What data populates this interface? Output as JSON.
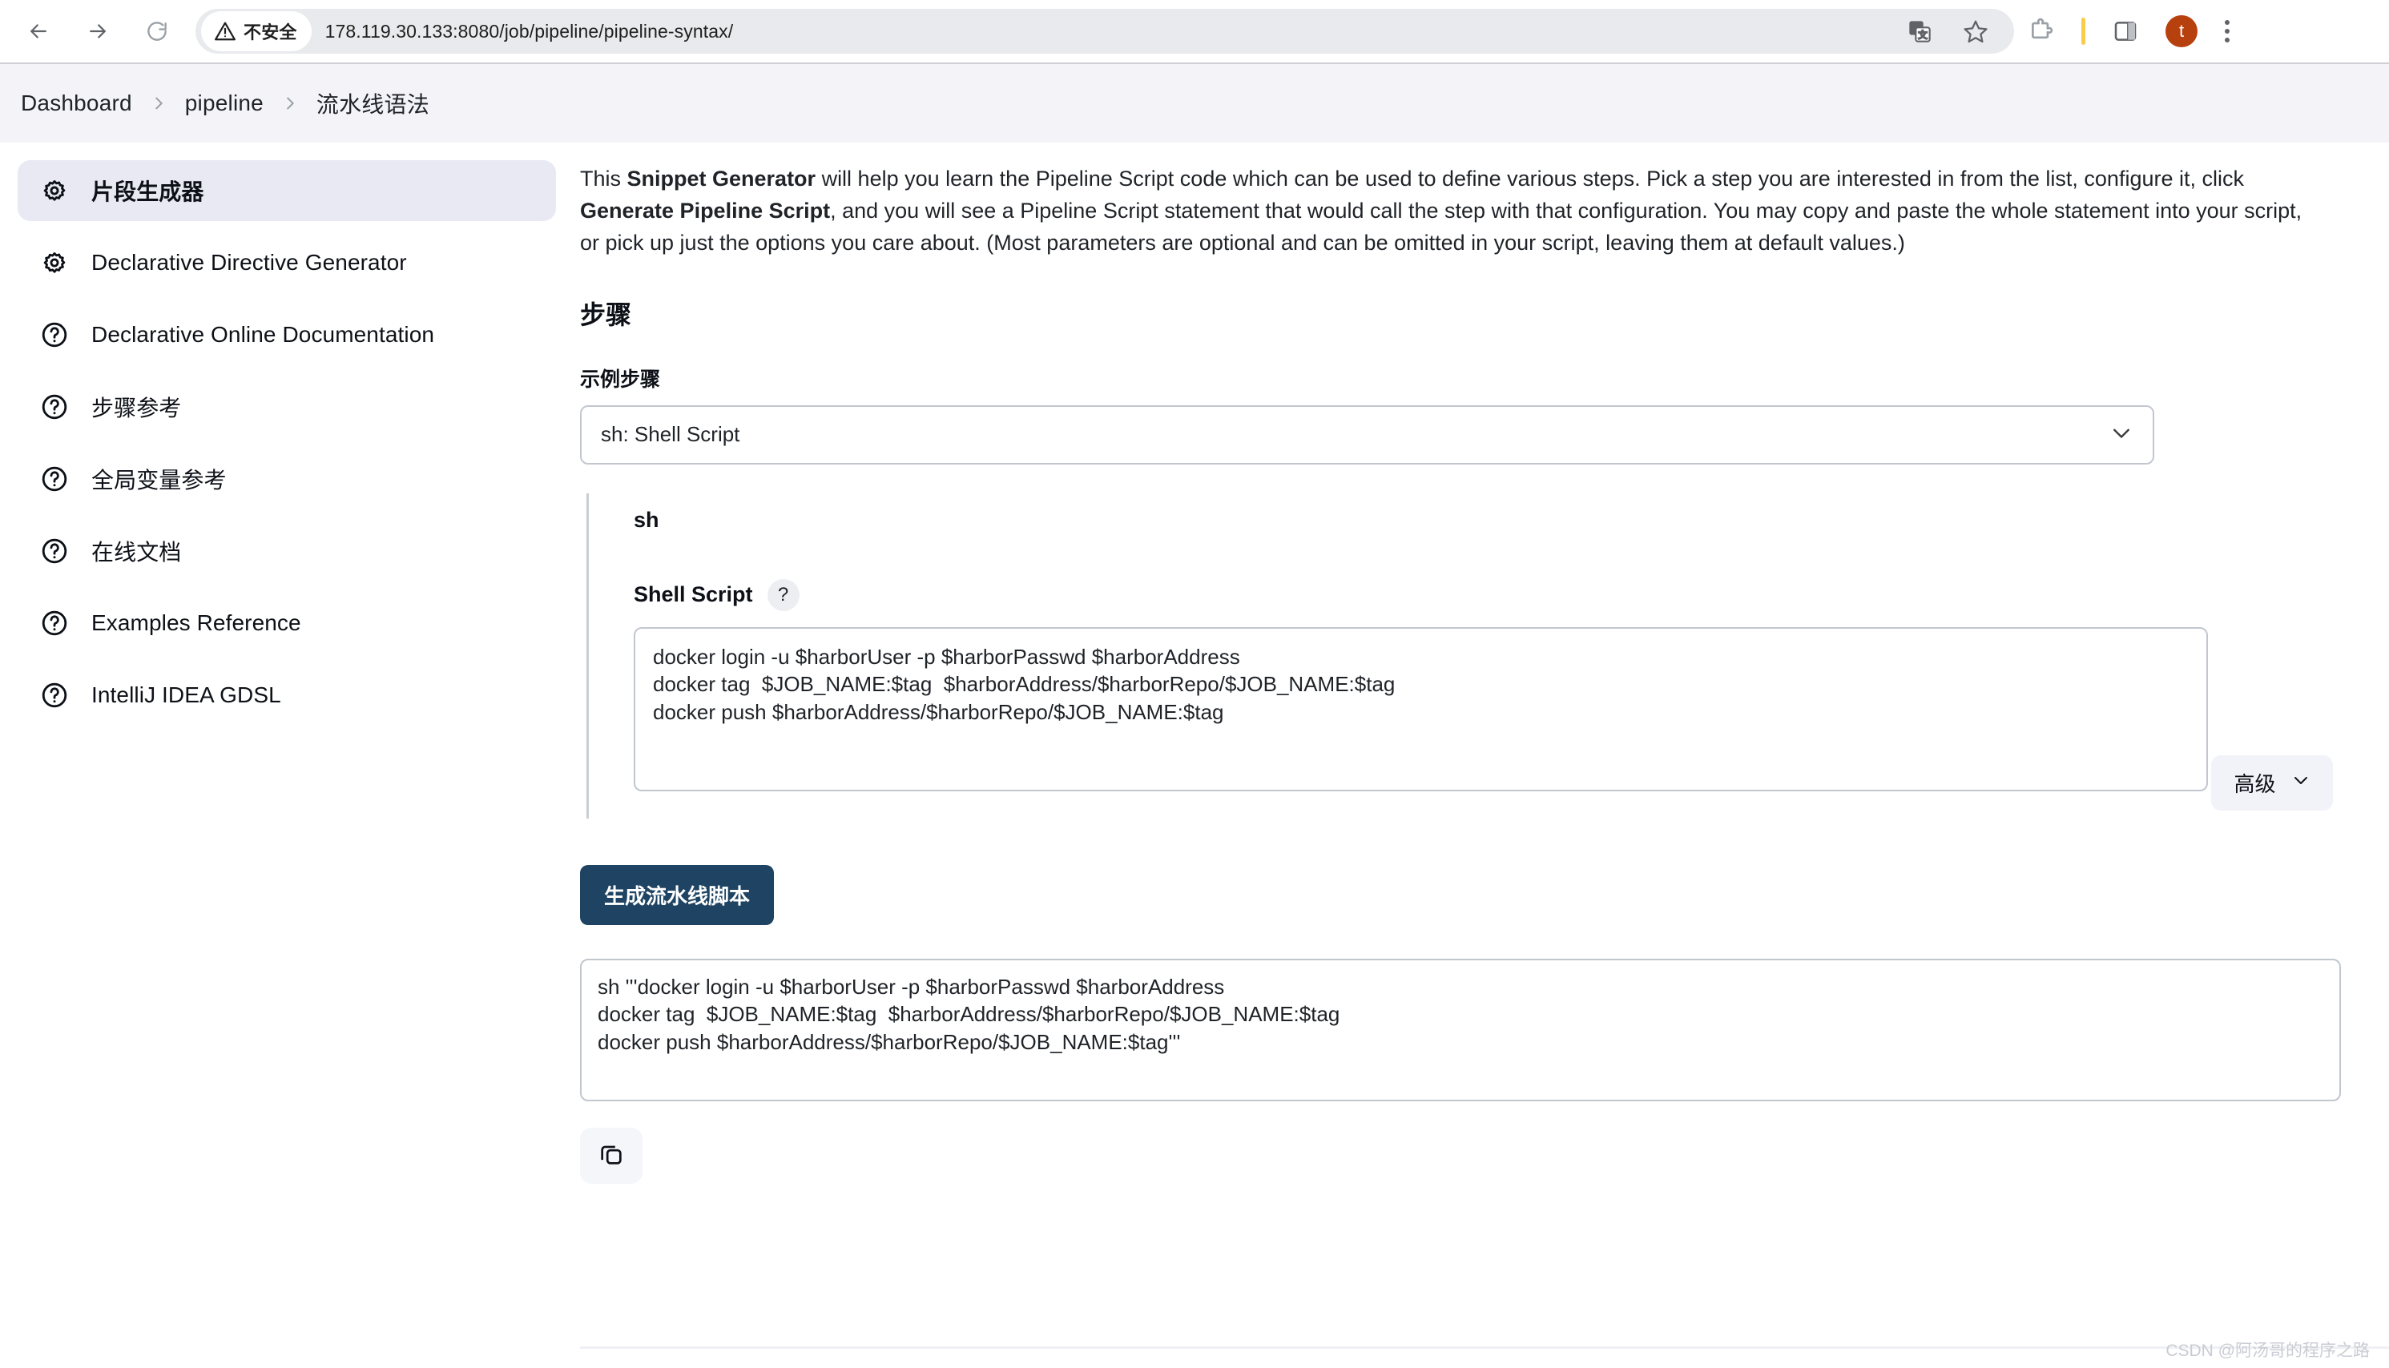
{
  "browser": {
    "back_icon": "back-arrow-icon",
    "forward_icon": "forward-arrow-icon",
    "reload_icon": "reload-icon",
    "security_label": "不安全",
    "url": "178.119.30.133:8080/job/pipeline/pipeline-syntax/",
    "translate_icon": "translate-icon",
    "bookmark_icon": "star-icon",
    "extensions_icon": "puzzle-icon",
    "side_panel_icon": "side-panel-icon",
    "profile_initial": "t",
    "menu_icon": "kebab-menu-icon"
  },
  "breadcrumb": {
    "items": [
      {
        "label": "Dashboard"
      },
      {
        "label": "pipeline"
      },
      {
        "label": "流水线语法"
      }
    ]
  },
  "sidebar": {
    "items": [
      {
        "label": "片段生成器",
        "icon": "gear-icon",
        "active": true
      },
      {
        "label": "Declarative Directive Generator",
        "icon": "gear-icon",
        "active": false
      },
      {
        "label": "Declarative Online Documentation",
        "icon": "help-circle-icon",
        "active": false
      },
      {
        "label": "步骤参考",
        "icon": "help-circle-icon",
        "active": false
      },
      {
        "label": "全局变量参考",
        "icon": "help-circle-icon",
        "active": false
      },
      {
        "label": "在线文档",
        "icon": "help-circle-icon",
        "active": false
      },
      {
        "label": "Examples Reference",
        "icon": "help-circle-icon",
        "active": false
      },
      {
        "label": "IntelliJ IDEA GDSL",
        "icon": "help-circle-icon",
        "active": false
      }
    ]
  },
  "main": {
    "intro": {
      "p1": "This ",
      "b1": "Snippet Generator",
      "p2": " will help you learn the Pipeline Script code which can be used to define various steps. Pick a step you are interested in from the list, configure it, click ",
      "b2": "Generate Pipeline Script",
      "p3": ", and you will see a Pipeline Script statement that would call the step with that configuration. You may copy and paste the whole statement into your script, or pick up just the options you care about. (Most parameters are optional and can be omitted in your script, leaving them at default values.)"
    },
    "steps_heading": "步骤",
    "sample_step_label": "示例步骤",
    "step_select": {
      "value": "sh: Shell Script",
      "caret_icon": "chevron-down-icon"
    },
    "step_card": {
      "name": "sh",
      "param_label": "Shell Script",
      "help_icon": "question-mark-icon",
      "script_value": "docker login -u $harborUser -p $harborPasswd $harborAddress\ndocker tag  $JOB_NAME:$tag  $harborAddress/$harborRepo/$JOB_NAME:$tag\ndocker push $harborAddress/$harborRepo/$JOB_NAME:$tag",
      "advanced_label": "高级",
      "advanced_caret_icon": "chevron-down-icon"
    },
    "generate_button": "生成流水线脚本",
    "generated_script": "sh '''docker login -u $harborUser -p $harborPasswd $harborAddress\ndocker tag  $JOB_NAME:$tag  $harborAddress/$harborRepo/$JOB_NAME:$tag\ndocker push $harborAddress/$harborRepo/$JOB_NAME:$tag'''",
    "copy_icon": "copy-icon"
  },
  "watermark": "CSDN @阿汤哥的程序之路",
  "colors": {
    "accent_button": "#1f4463",
    "sidebar_active_bg": "#e8e9f3",
    "crumb_band_bg": "#f4f4f8",
    "border": "#c2c7cf",
    "avatar": "#b7410e"
  }
}
